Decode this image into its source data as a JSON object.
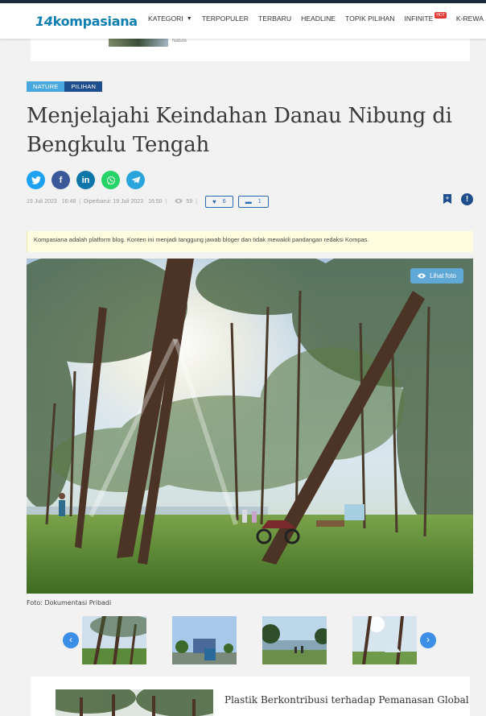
{
  "header": {
    "logo_number": "14",
    "logo_text": "kompasiana",
    "nav": [
      {
        "label": "KATEGORI"
      },
      {
        "label": "TERPOPULER"
      },
      {
        "label": "TERBARU"
      },
      {
        "label": "HEADLINE"
      },
      {
        "label": "TOPIK PILIHAN"
      },
      {
        "label": "INFINITE"
      },
      {
        "label": "K-REWA"
      }
    ],
    "hot_badge": "HOT"
  },
  "prev_strip": {
    "label": "Nature"
  },
  "article": {
    "tags": [
      "NATURE",
      "PILIHAN"
    ],
    "title": "Menjelajahi Keindahan Danau Nibung di Bengkulu Tengah",
    "published": "19 Juli 2023",
    "published_time": "16:48",
    "updated_prefix": "Diperbarui: 19 Juli 2023",
    "updated_time": "16:50",
    "views": "59",
    "likes": "6",
    "comments": "1",
    "notice": "Kompasiana adalah platform blog. Konten ini menjadi tanggung jawab bloger dan tidak mewakili pandangan redaksi Kompas.",
    "photo_button": "Lihat foto",
    "photo_caption": "Foto: Dokumentasi Pribadi"
  },
  "share_icons": [
    "twitter-icon",
    "facebook-icon",
    "linkedin-icon",
    "whatsapp-icon",
    "telegram-icon"
  ],
  "related": {
    "title": "Plastik Berkontribusi terhadap Pemanasan Global"
  },
  "colors": {
    "brand": "#0e7fb0",
    "tag_nature": "#4aa8e0",
    "tag_pilihan": "#1f4e8c",
    "accent_blue": "#2d6bb0",
    "notice_bg": "#fffde0"
  }
}
